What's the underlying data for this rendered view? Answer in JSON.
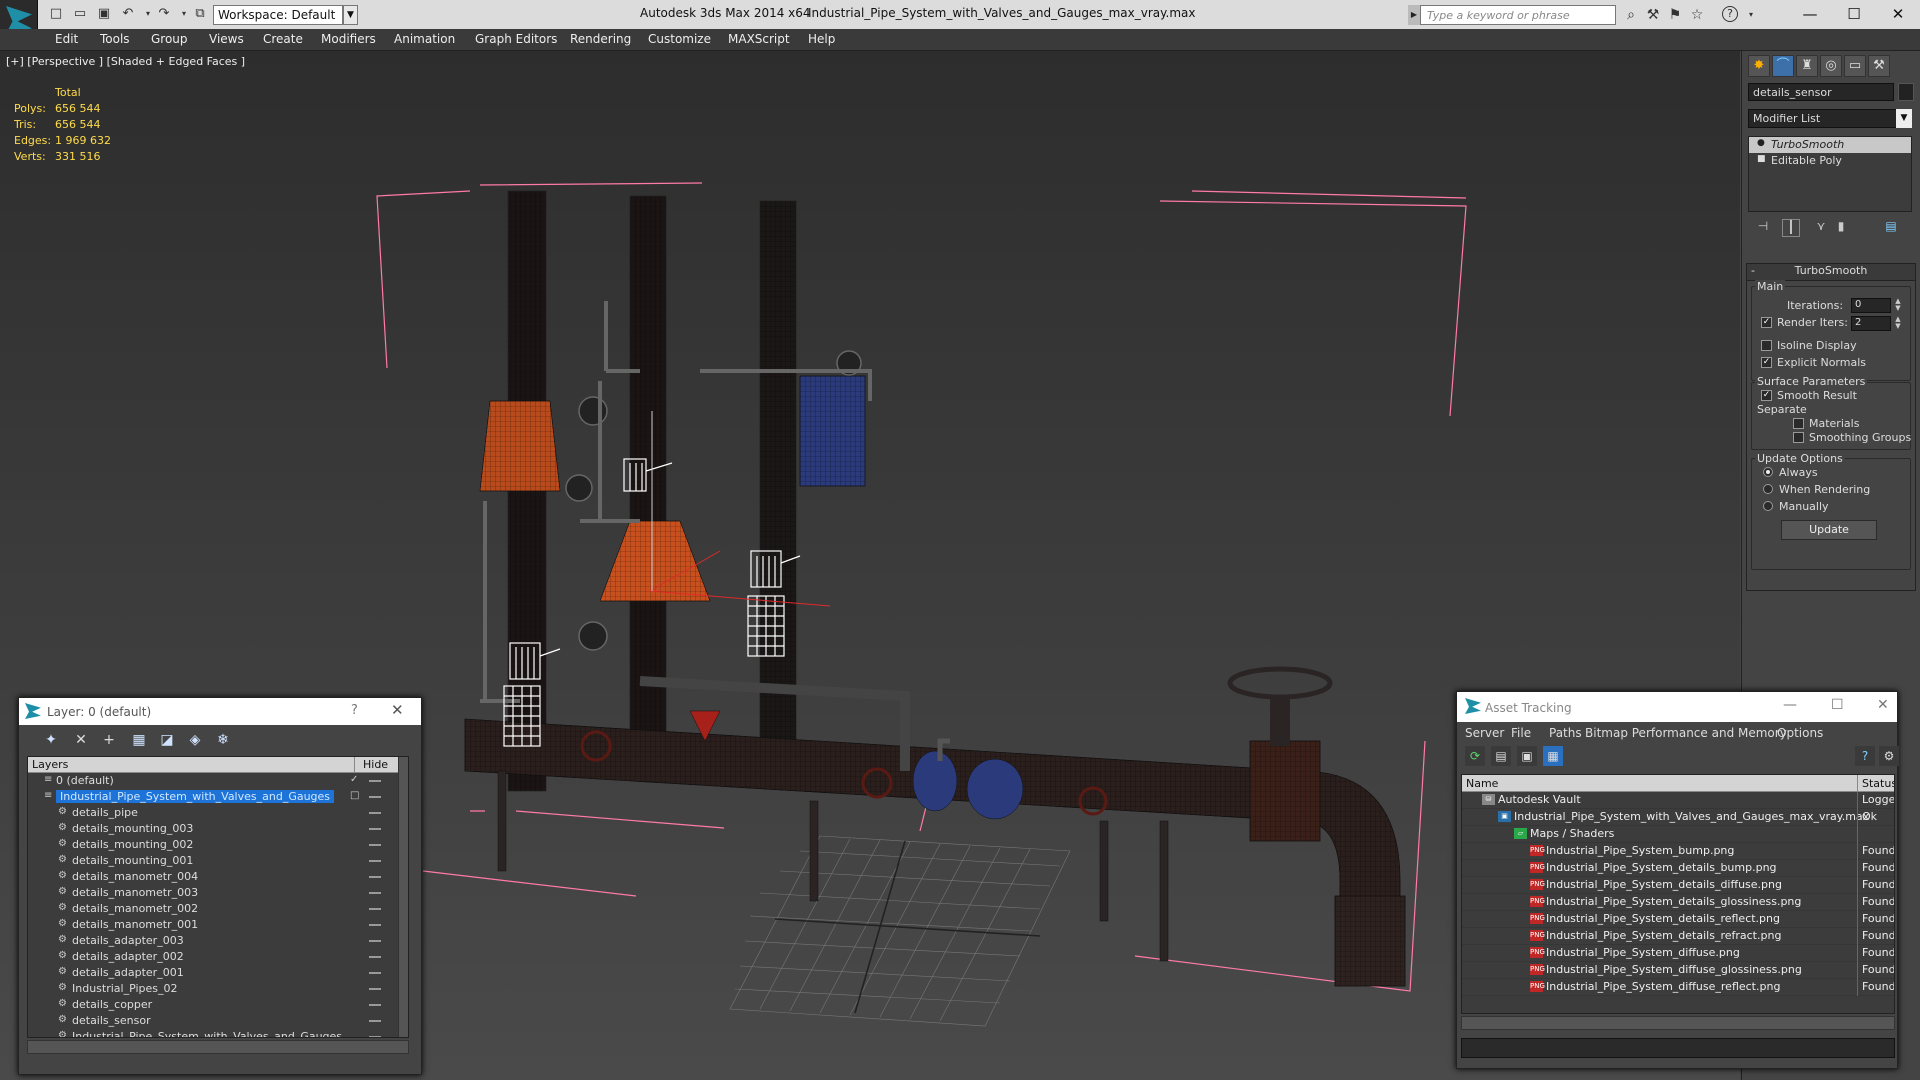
{
  "titlebar": {
    "workspace": "Workspace: Default",
    "app_title": "Autodesk 3ds Max  2014 x64",
    "file_title": "Industrial_Pipe_System_with_Valves_and_Gauges_max_vray.max",
    "search_placeholder": "Type a keyword or phrase"
  },
  "menubar": [
    "Edit",
    "Tools",
    "Group",
    "Views",
    "Create",
    "Modifiers",
    "Animation",
    "Graph Editors",
    "Rendering",
    "Customize",
    "MAXScript",
    "Help"
  ],
  "viewport": {
    "label": "[+] [Perspective ] [Shaded + Edged Faces ]",
    "stats": {
      "header": "Total",
      "rows": [
        {
          "key": "Polys:",
          "value": "656 544"
        },
        {
          "key": "Tris:",
          "value": "656 544"
        },
        {
          "key": "Edges:",
          "value": "1 969 632"
        },
        {
          "key": "Verts:",
          "value": "331 516"
        }
      ]
    }
  },
  "command_panel": {
    "object_name": "details_sensor",
    "modifier_list": "Modifier List",
    "stack": [
      "TurboSmooth",
      "Editable Poly"
    ],
    "rollout_title": "TurboSmooth",
    "main_group": "Main",
    "iterations_label": "Iterations:",
    "iterations_value": "0",
    "render_iters_label": "Render Iters:",
    "render_iters_value": "2",
    "isoline_label": "Isoline Display",
    "explicit_normals_label": "Explicit Normals",
    "surface_group": "Surface Parameters",
    "smooth_result_label": "Smooth Result",
    "separate_label": "Separate",
    "materials_label": "Materials",
    "smoothing_groups_label": "Smoothing Groups",
    "update_group": "Update Options",
    "always_label": "Always",
    "when_rendering_label": "When Rendering",
    "manually_label": "Manually",
    "update_button": "Update"
  },
  "layer_window": {
    "title": "Layer: 0 (default)",
    "help": "?",
    "col_layers": "Layers",
    "col_hide": "Hide",
    "rows": [
      {
        "name": "0 (default)",
        "level": 0
      },
      {
        "name": "Industrial_Pipe_System_with_Valves_and_Gauges",
        "level": 0,
        "selected": true
      },
      {
        "name": "details_pipe",
        "level": 1
      },
      {
        "name": "details_mounting_003",
        "level": 1
      },
      {
        "name": "details_mounting_002",
        "level": 1
      },
      {
        "name": "details_mounting_001",
        "level": 1
      },
      {
        "name": "details_manometr_004",
        "level": 1
      },
      {
        "name": "details_manometr_003",
        "level": 1
      },
      {
        "name": "details_manometr_002",
        "level": 1
      },
      {
        "name": "details_manometr_001",
        "level": 1
      },
      {
        "name": "details_adapter_003",
        "level": 1
      },
      {
        "name": "details_adapter_002",
        "level": 1
      },
      {
        "name": "details_adapter_001",
        "level": 1
      },
      {
        "name": "Industrial_Pipes_02",
        "level": 1
      },
      {
        "name": "details_copper",
        "level": 1
      },
      {
        "name": "details_sensor",
        "level": 1
      },
      {
        "name": "Industrial_Pipe_System_with_Valves_and_Gauges",
        "level": 1
      }
    ]
  },
  "asset_tracking": {
    "title": "Asset Tracking",
    "menu": [
      "Server",
      "File",
      "Paths",
      "Bitmap Performance and Memory",
      "Options"
    ],
    "col_name": "Name",
    "col_status": "Status",
    "rows": [
      {
        "name": "Autodesk Vault",
        "status": "Logged",
        "level": 0,
        "icon": "vault"
      },
      {
        "name": "Industrial_Pipe_System_with_Valves_and_Gauges_max_vray.max",
        "status": "Ok",
        "level": 1,
        "icon": "max"
      },
      {
        "name": "Maps / Shaders",
        "status": "",
        "level": 2,
        "icon": "folder"
      },
      {
        "name": "Industrial_Pipe_System_bump.png",
        "status": "Found",
        "level": 3,
        "icon": "png"
      },
      {
        "name": "Industrial_Pipe_System_details_bump.png",
        "status": "Found",
        "level": 3,
        "icon": "png"
      },
      {
        "name": "Industrial_Pipe_System_details_diffuse.png",
        "status": "Found",
        "level": 3,
        "icon": "png"
      },
      {
        "name": "Industrial_Pipe_System_details_glossiness.png",
        "status": "Found",
        "level": 3,
        "icon": "png"
      },
      {
        "name": "Industrial_Pipe_System_details_reflect.png",
        "status": "Found",
        "level": 3,
        "icon": "png"
      },
      {
        "name": "Industrial_Pipe_System_details_refract.png",
        "status": "Found",
        "level": 3,
        "icon": "png"
      },
      {
        "name": "Industrial_Pipe_System_diffuse.png",
        "status": "Found",
        "level": 3,
        "icon": "png"
      },
      {
        "name": "Industrial_Pipe_System_diffuse_glossiness.png",
        "status": "Found",
        "level": 3,
        "icon": "png"
      },
      {
        "name": "Industrial_Pipe_System_diffuse_reflect.png",
        "status": "Found",
        "level": 3,
        "icon": "png"
      }
    ]
  },
  "colors": {
    "accent": "#1e73d8",
    "stats": "#ffdc4a",
    "selection_bracket": "#ff7aa8",
    "pipe_orange": "#b84a1c",
    "valve_red": "#a8201a",
    "valve_blue": "#2a3a7a"
  }
}
